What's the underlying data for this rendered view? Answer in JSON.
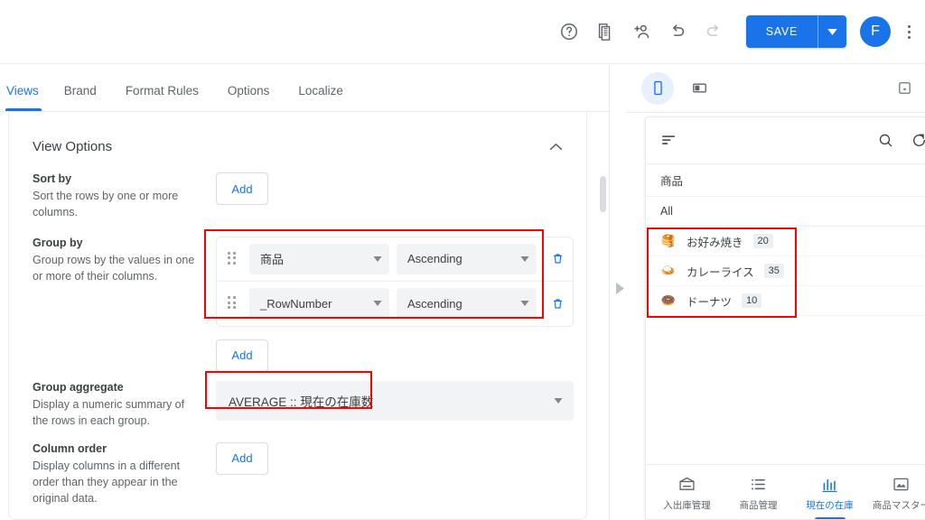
{
  "topbar": {
    "icons": [
      {
        "name": "help-icon",
        "glyph": "?"
      },
      {
        "name": "copy-app-icon",
        "glyph": "app"
      },
      {
        "name": "add-person-icon",
        "glyph": "person-add"
      },
      {
        "name": "undo-icon",
        "glyph": "undo"
      },
      {
        "name": "redo-icon",
        "glyph": "redo"
      }
    ],
    "save_label": "SAVE",
    "avatar_initial": "F"
  },
  "editor": {
    "tabs": [
      {
        "label": "Views",
        "active": true
      },
      {
        "label": "Brand",
        "active": false
      },
      {
        "label": "Format Rules",
        "active": false
      },
      {
        "label": "Options",
        "active": false
      },
      {
        "label": "Localize",
        "active": false
      }
    ],
    "card_title": "View Options",
    "sections": {
      "sort_by": {
        "title": "Sort by",
        "description": "Sort the rows by one or more columns.",
        "add_label": "Add"
      },
      "group_by": {
        "title": "Group by",
        "description": "Group rows by the values in one or more of their columns.",
        "add_label": "Add",
        "rows": [
          {
            "column": "商品",
            "direction": "Ascending"
          },
          {
            "column": "_RowNumber",
            "direction": "Ascending"
          }
        ]
      },
      "group_aggregate": {
        "title": "Group aggregate",
        "description": "Display a numeric summary of the rows in each group.",
        "value": "AVERAGE :: 現在の在庫数"
      },
      "column_order": {
        "title": "Column order",
        "description": "Display columns in a different order than they appear in the original data.",
        "add_label": "Add"
      }
    }
  },
  "preview": {
    "device_toggles": [
      {
        "name": "phone-view-toggle",
        "active": true
      },
      {
        "name": "tablet-view-toggle",
        "active": false
      }
    ],
    "app": {
      "header_icons": [
        "sort-icon",
        "search-icon",
        "refresh-icon"
      ],
      "column_title": "商品",
      "all_label": "All",
      "items": [
        {
          "emoji": "🥞",
          "name": "お好み焼き",
          "count": "20"
        },
        {
          "emoji": "🍛",
          "name": "カレーライス",
          "count": "35"
        },
        {
          "emoji": "🍩",
          "name": "ドーナツ",
          "count": "10"
        }
      ],
      "nav": [
        {
          "label": "入出庫管理",
          "icon": "inbox-icon",
          "active": false
        },
        {
          "label": "商品管理",
          "icon": "list-icon",
          "active": false
        },
        {
          "label": "現在の在庫",
          "icon": "chart-icon",
          "active": true
        },
        {
          "label": "商品マスター",
          "icon": "image-icon",
          "active": false
        }
      ]
    }
  },
  "annotations": {
    "highlight_color": "#ff0000",
    "boxes": [
      "group-by-rows",
      "group-aggregate-value",
      "preview-grouped-items"
    ]
  }
}
